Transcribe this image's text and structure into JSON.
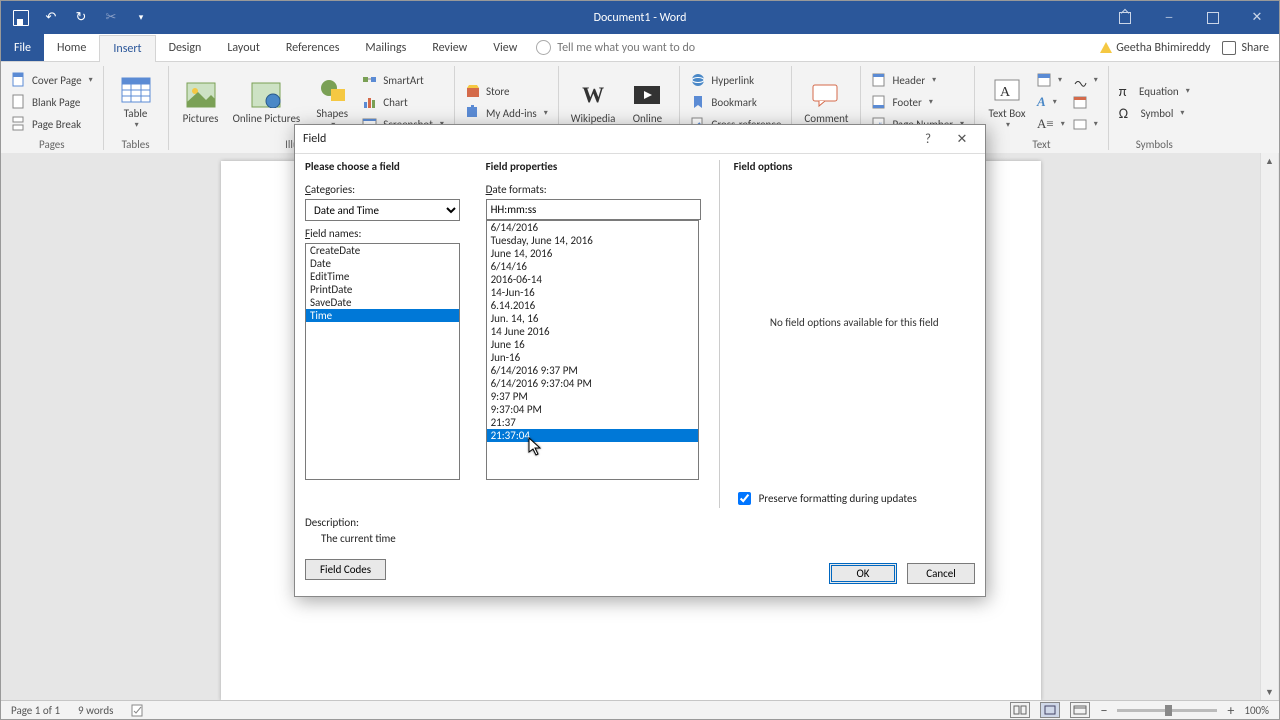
{
  "title": "Document1 - Word",
  "user": "Geetha Bhimireddy",
  "share": "Share",
  "tell_me": "Tell me what you want to do",
  "tabs": [
    "File",
    "Home",
    "Insert",
    "Design",
    "Layout",
    "References",
    "Mailings",
    "Review",
    "View"
  ],
  "active_tab": "Insert",
  "ribbon": {
    "pages": {
      "label": "Pages",
      "cover": "Cover Page",
      "blank": "Blank Page",
      "break": "Page Break"
    },
    "tables": {
      "label": "Tables",
      "table": "Table"
    },
    "illus": {
      "label": "Illustrations",
      "pictures": "Pictures",
      "online": "Online Pictures",
      "shapes": "Shapes",
      "smartart": "SmartArt",
      "chart": "Chart",
      "screenshot": "Screenshot"
    },
    "addins": {
      "store": "Store",
      "my": "My Add-ins"
    },
    "wiki": "Wikipedia",
    "online_video": "Online",
    "links": {
      "hyper": "Hyperlink",
      "book": "Bookmark",
      "cross": "Cross-reference"
    },
    "comment": "Comment",
    "headerfooter": {
      "header": "Header",
      "footer": "Footer",
      "page": "Page Number"
    },
    "text": {
      "label": "Text",
      "box": "Text Box"
    },
    "symbols": {
      "label": "Symbols",
      "eq": "Equation",
      "sym": "Symbol"
    }
  },
  "status": {
    "page": "Page 1 of 1",
    "words": "9 words",
    "zoom": "100%"
  },
  "dialog": {
    "title": "Field",
    "choose": "Please choose a field",
    "categories_lab": "Categories:",
    "category_value": "Date and Time",
    "fieldnames_lab": "Field names:",
    "field_names": [
      "CreateDate",
      "Date",
      "EditTime",
      "PrintDate",
      "SaveDate",
      "Time"
    ],
    "selected_field": "Time",
    "props_title": "Field properties",
    "dateformats_lab": "Date formats:",
    "format_value": "HH:mm:ss",
    "formats": [
      "6/14/2016",
      "Tuesday, June 14, 2016",
      "June 14, 2016",
      "6/14/16",
      "2016-06-14",
      "14-Jun-16",
      "6.14.2016",
      "Jun. 14, 16",
      "14 June 2016",
      "June 16",
      "Jun-16",
      "6/14/2016 9:37 PM",
      "6/14/2016 9:37:04 PM",
      "9:37 PM",
      "9:37:04 PM",
      "21:37",
      "21:37:04"
    ],
    "selected_format": "21:37:04",
    "options_title": "Field options",
    "no_options": "No field options available for this field",
    "preserve": "Preserve formatting during updates",
    "description_lab": "Description:",
    "description": "The current time",
    "field_codes": "Field Codes",
    "ok": "OK",
    "cancel": "Cancel"
  }
}
